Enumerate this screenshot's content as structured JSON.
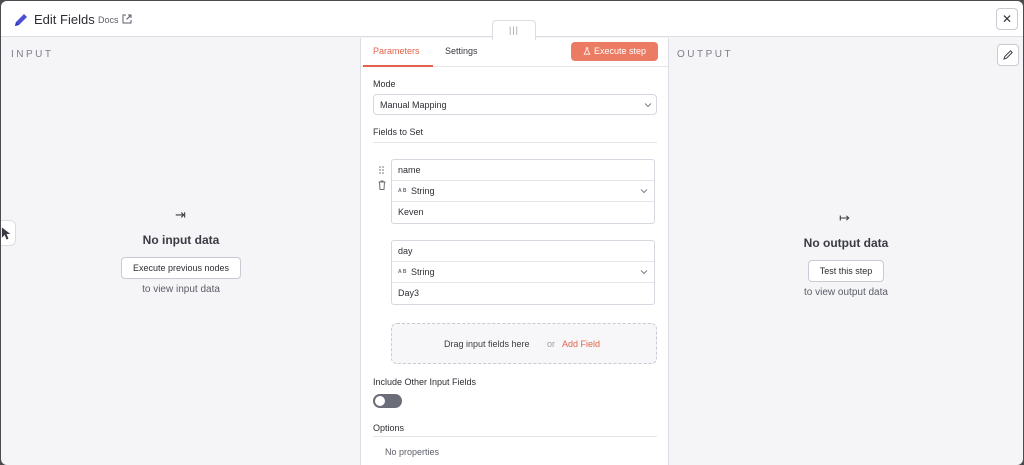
{
  "header": {
    "title": "Edit Fields",
    "docs_label": "Docs",
    "close_label": "✕",
    "drag_handle": "|||"
  },
  "input_panel": {
    "label": "INPUT",
    "icon_glyph": "⇥",
    "empty_title": "No input data",
    "button_label": "Execute previous nodes",
    "subtext": "to view input data"
  },
  "output_panel": {
    "label": "OUTPUT",
    "icon_glyph": "↦",
    "empty_title": "No output data",
    "button_label": "Test this step",
    "subtext": "to view output data"
  },
  "center": {
    "tabs": [
      {
        "label": "Parameters",
        "active": true
      },
      {
        "label": "Settings",
        "active": false
      }
    ],
    "execute_label": "Execute step",
    "mode_label": "Mode",
    "mode_value": "Manual Mapping",
    "fields_to_set_label": "Fields to Set",
    "fields": [
      {
        "name": "name",
        "type_badge": "A B",
        "type": "String",
        "value": "Keven"
      },
      {
        "name": "day",
        "type_badge": "A B",
        "type": "String",
        "value": "Day3"
      }
    ],
    "dropzone": {
      "text": "Drag input fields here",
      "or": "or",
      "add_label": "Add Field"
    },
    "include_label": "Include Other Input Fields",
    "include_on": false,
    "options_label": "Options",
    "no_properties": "No properties"
  },
  "colors": {
    "accent": "#e2634a",
    "execute_bg": "#ec7b64",
    "panel_bg": "#f5f5f7"
  }
}
